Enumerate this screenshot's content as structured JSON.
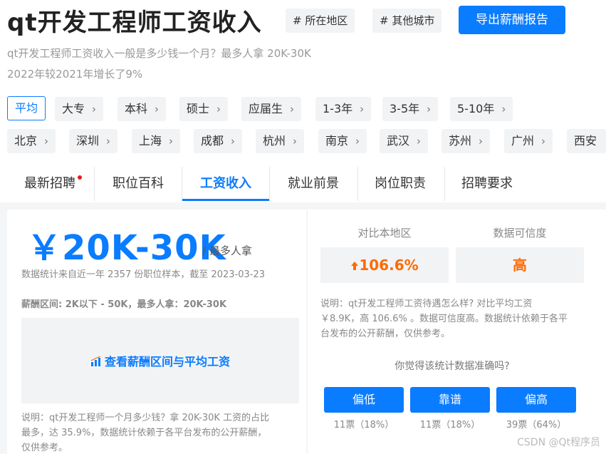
{
  "header": {
    "title": "qt开发工程师工资收入",
    "tags": [
      "# 所在地区",
      "# 其他城市"
    ],
    "export_label": "导出薪酬报告"
  },
  "summary": {
    "line1": "qt开发工程师工资收入一般是多少钱一个月？最多人拿 20K-30K",
    "line2": "2022年较2021年增长了9%"
  },
  "filters": {
    "education": [
      "平均",
      "大专",
      "本科",
      "硕士",
      "应届生",
      "1-3年",
      "3-5年",
      "5-10年"
    ],
    "cities": [
      "北京",
      "深圳",
      "上海",
      "成都",
      "杭州",
      "南京",
      "武汉",
      "苏州",
      "广州",
      "西安"
    ],
    "chevron": "›"
  },
  "tabs": [
    "最新招聘",
    "职位百科",
    "工资收入",
    "就业前景",
    "岗位职责",
    "招聘要求"
  ],
  "salary": {
    "range": "￥20K-30K",
    "suffix": "/ 最多人拿",
    "stat": "数据统计来自近一年 2357 份职位样本，截至 2023-03-23",
    "range_line": "薪酬区间: 2K以下 - 50K，最多人拿：20K-30K",
    "view_link": "查看薪酬区间与平均工资",
    "explain": [
      "说明：qt开发工程师一个月多少钱？拿 20K-30K 工资的占比",
      "最多，达 35.9%，数据统计依赖于各平台发布的公开薪酬，",
      "仅供参考。"
    ]
  },
  "compare": {
    "heads": [
      "对比本地区",
      "数据可信度"
    ],
    "increase": "106.6%",
    "reliability": "高",
    "explain": [
      "说明：qt开发工程师工资待遇怎么样? 对比平均工资",
      "￥8.9K，高 106.6% 。数据可信度高。数据统计依赖于各平",
      "台发布的公开薪酬，仅供参考。"
    ],
    "question": "你觉得该统计数据准确吗?",
    "votes": [
      {
        "label": "偏低",
        "count": "11票（18%）"
      },
      {
        "label": "靠谱",
        "count": "11票（18%）"
      },
      {
        "label": "偏高",
        "count": "39票（64%）"
      }
    ],
    "accent_color": "#ff6a00"
  },
  "watermark": "CSDN @Qt程序员",
  "colors": {
    "brand": "#0a7cff",
    "increase": "#ff6a00"
  }
}
